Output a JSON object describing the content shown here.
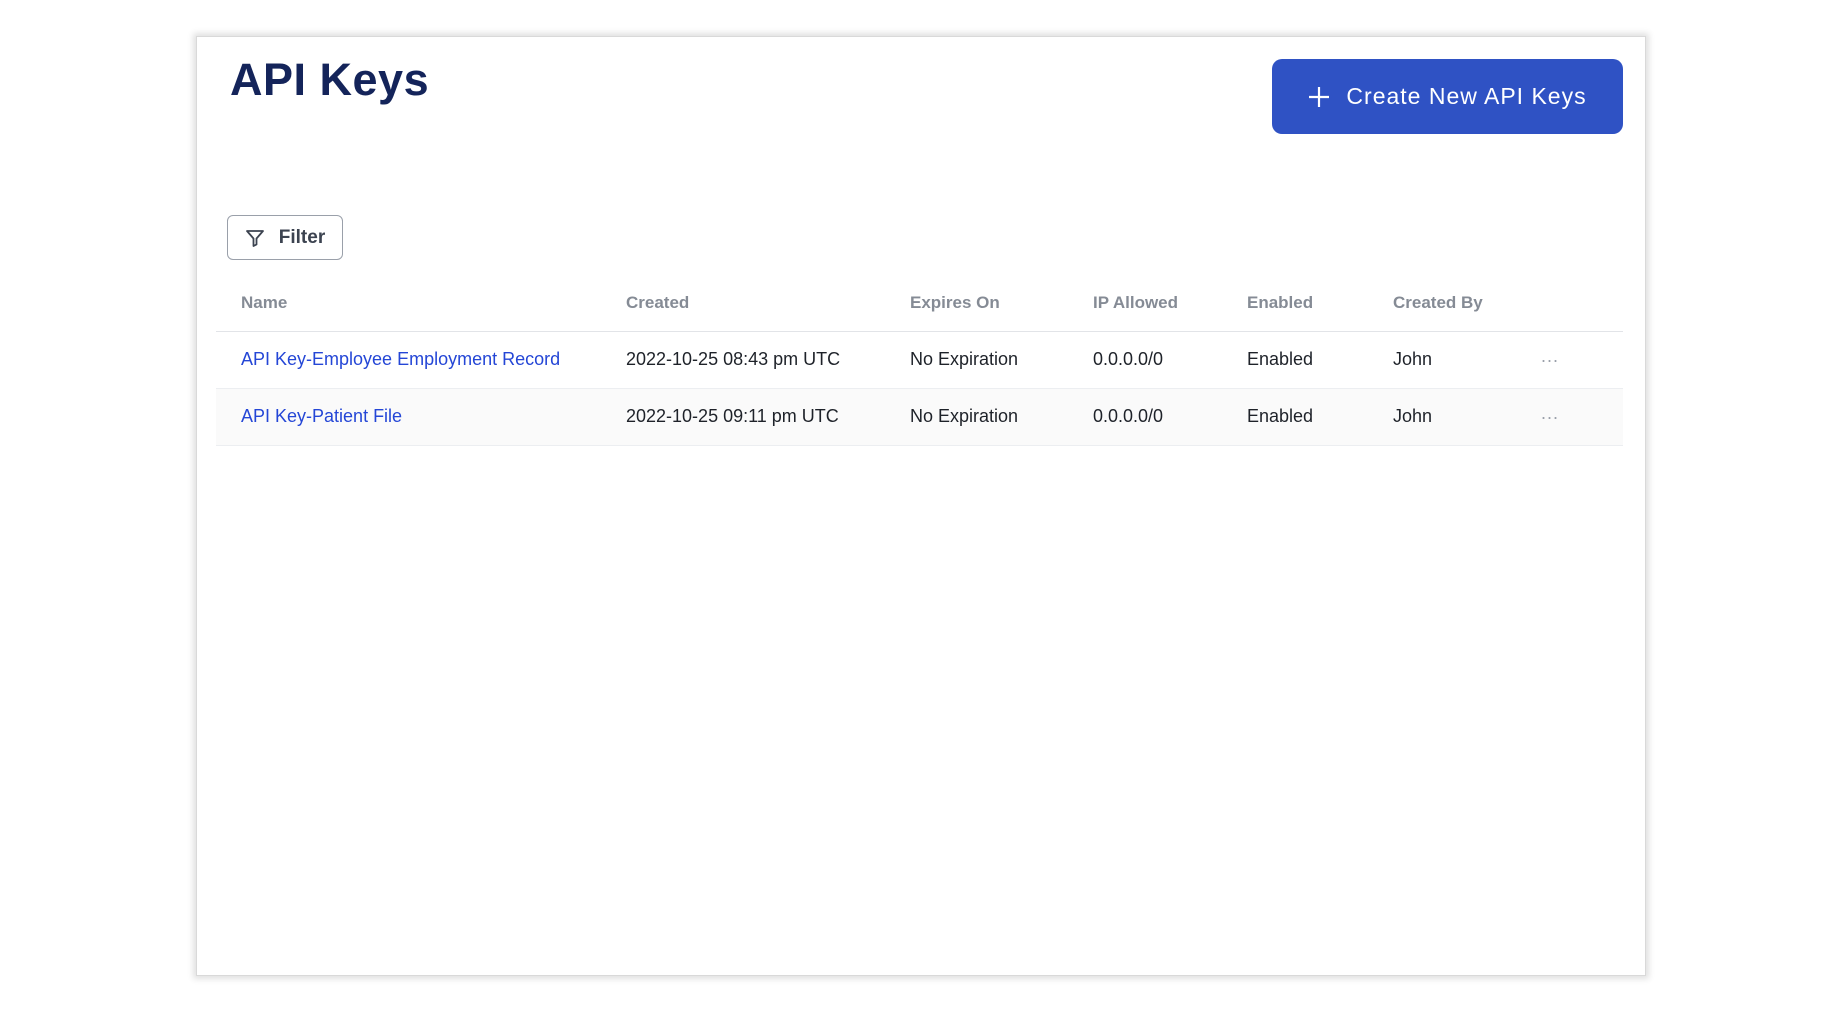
{
  "header": {
    "title": "API Keys",
    "create_button_label": "Create New API Keys"
  },
  "toolbar": {
    "filter_label": "Filter"
  },
  "table": {
    "columns": [
      "Name",
      "Created",
      "Expires On",
      "IP Allowed",
      "Enabled",
      "Created By"
    ],
    "rows": [
      {
        "name": "API Key-Employee Employment Record",
        "created": "2022-10-25 08:43 pm UTC",
        "expires_on": "No Expiration",
        "ip_allowed": "0.0.0.0/0",
        "enabled": "Enabled",
        "created_by": "John",
        "actions": "..."
      },
      {
        "name": "API Key-Patient File",
        "created": "2022-10-25 09:11 pm UTC",
        "expires_on": "No Expiration",
        "ip_allowed": "0.0.0.0/0",
        "enabled": "Enabled",
        "created_by": "John",
        "actions": "..."
      }
    ]
  },
  "icons": {
    "create": "plus-icon",
    "filter": "filter-funnel-icon",
    "row_actions": "more-horizontal-icon"
  },
  "colors": {
    "title": "#14245a",
    "primary_button": "#2f52c4",
    "link": "#2446d6",
    "header_text": "#858b95"
  }
}
